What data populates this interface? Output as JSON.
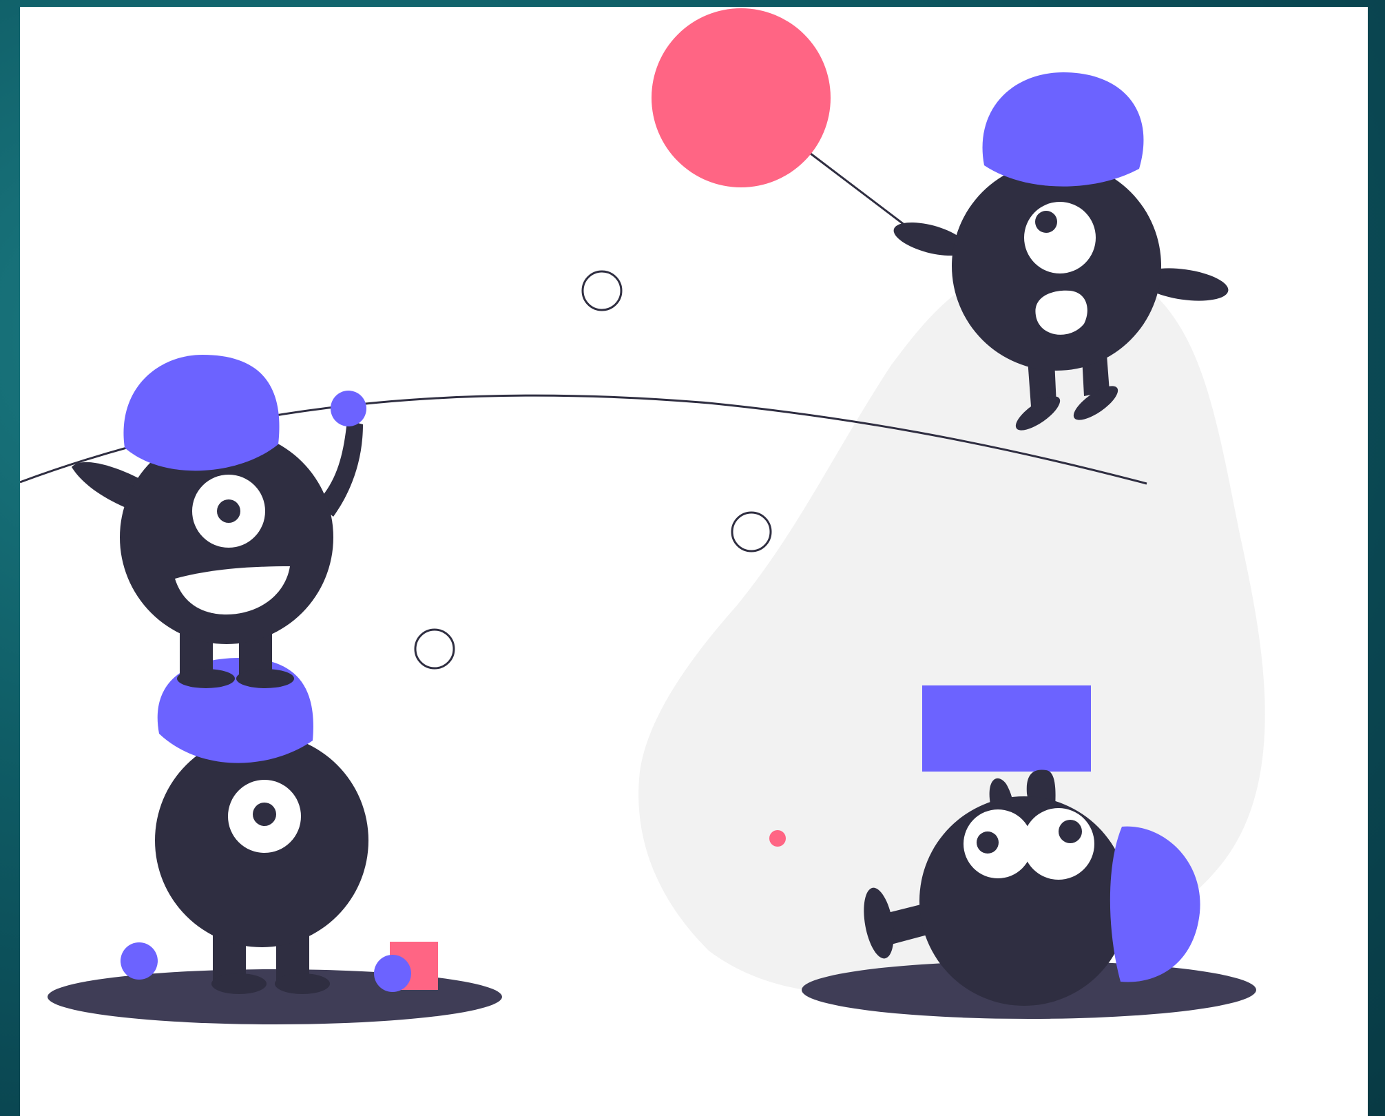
{
  "colors": {
    "background": "#0d5560",
    "canvas": "#ffffff",
    "dark": "#2f2e41",
    "purple": "#6c63ff",
    "pink": "#ff6584",
    "blob": "#f2f2f2",
    "shadow": "#3f3d56"
  },
  "illustration": {
    "characters": [
      "monster-top-left",
      "monster-bottom-left",
      "monster-flying",
      "monster-lying"
    ],
    "props": [
      "balloon",
      "rope",
      "rings",
      "cube",
      "sign",
      "balls"
    ]
  }
}
